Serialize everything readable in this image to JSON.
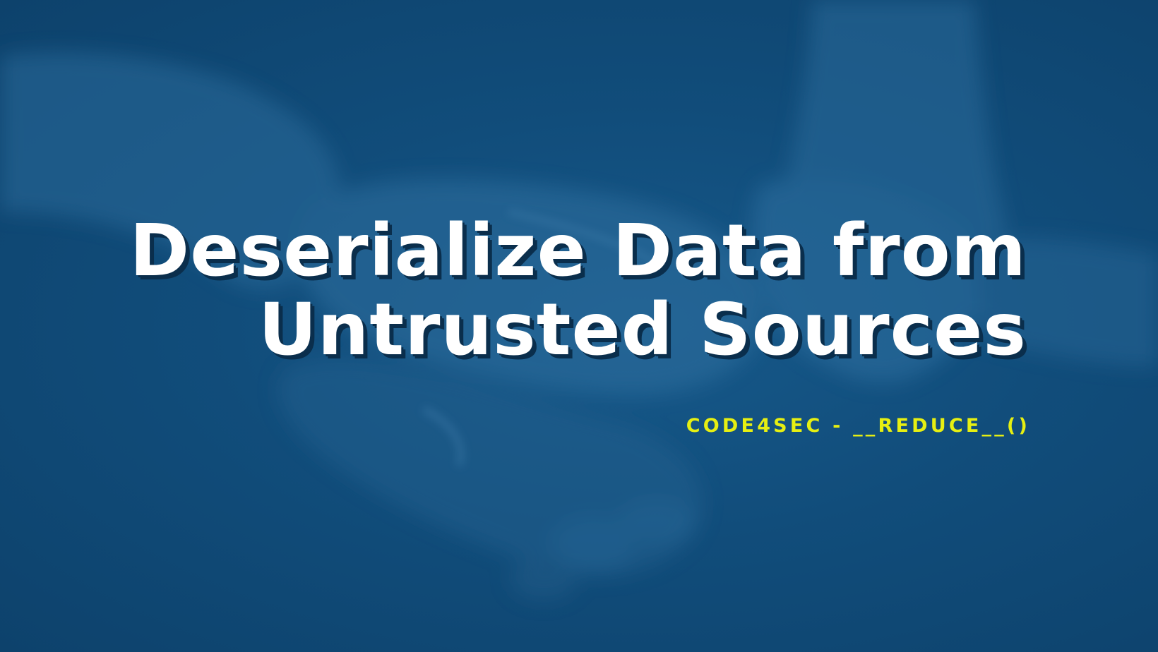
{
  "banner": {
    "title_line1": "Deserialize Data from",
    "title_line2": "Untrusted Sources",
    "subtitle": "CODE4SEC - __REDUCE__()"
  },
  "colors": {
    "background": "#104a76",
    "title": "#ffffff",
    "subtitle": "#e6ef12",
    "shadow": "#0a2e4c"
  },
  "background_image": "blue-tinted photo of several hands clasped together"
}
